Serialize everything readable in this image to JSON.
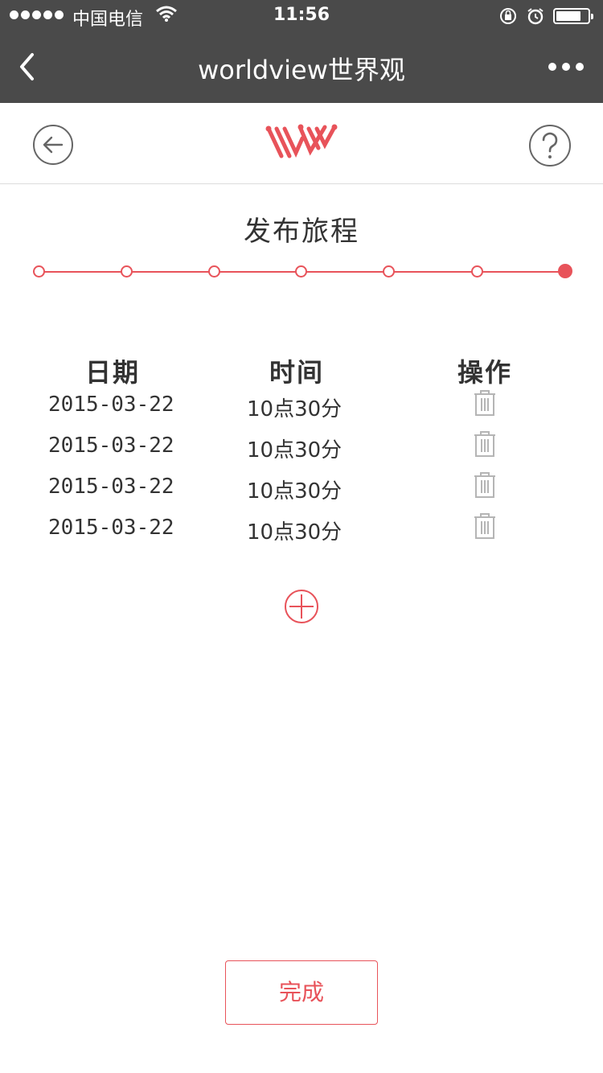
{
  "status_bar": {
    "carrier": "中国电信",
    "time": "11:56"
  },
  "nav": {
    "title": "worldview世界观"
  },
  "page": {
    "title": "发布旅程",
    "progress_steps": 7,
    "active_step": 7
  },
  "table": {
    "headers": [
      "日期",
      "时间",
      "操作"
    ],
    "rows": [
      {
        "date": "2015-03-22",
        "time": "10点30分"
      },
      {
        "date": "2015-03-22",
        "time": "10点30分"
      },
      {
        "date": "2015-03-22",
        "time": "10点30分"
      },
      {
        "date": "2015-03-22",
        "time": "10点30分"
      }
    ]
  },
  "actions": {
    "done_label": "完成"
  },
  "colors": {
    "accent": "#e8535a",
    "bar": "#4a4a4a",
    "icon_gray": "#b5b5b5"
  },
  "icons": {
    "back": "chevron-left-icon",
    "more": "more-icon",
    "circle_back": "arrow-left-circle-icon",
    "logo": "worldview-logo",
    "help": "question-circle-icon",
    "delete": "trash-icon",
    "add": "plus-circle-icon"
  }
}
